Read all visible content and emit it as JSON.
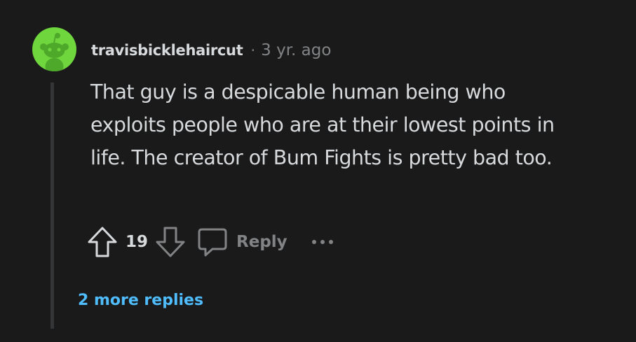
{
  "comment": {
    "username": "travisbicklehaircut",
    "separator": "·",
    "timestamp": "3 yr. ago",
    "body": "That guy is a despicable human being who exploits people who are at their lowest points in life. The creator of Bum Fights is pretty bad too.",
    "vote_count": "19",
    "reply_label": "Reply",
    "more_replies_label": "2 more replies"
  },
  "icons": {
    "avatar": "snoo-avatar-icon",
    "upvote": "upvote-arrow-icon",
    "downvote": "downvote-arrow-icon",
    "reply": "speech-bubble-icon",
    "more": "ellipsis-icon"
  },
  "colors": {
    "background": "#1a1a1b",
    "avatar_bg": "#6fd63e",
    "link": "#4fbcff",
    "text": "#d7dadc",
    "muted": "#818384"
  }
}
